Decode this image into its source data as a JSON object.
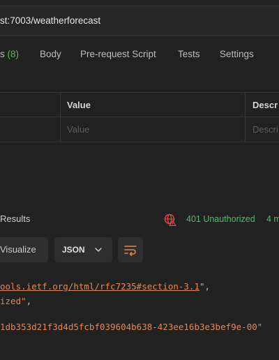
{
  "url_bar": {
    "url": "st:7003/weatherforecast"
  },
  "request_tabs": [
    {
      "label": "s",
      "count": "(8)"
    },
    {
      "label": "Body"
    },
    {
      "label": "Pre-request Script"
    },
    {
      "label": "Tests"
    },
    {
      "label": "Settings"
    }
  ],
  "params_table": {
    "headers": {
      "value": "Value",
      "description": "Descr"
    },
    "placeholders": {
      "value": "Value",
      "description": "Descri"
    }
  },
  "response": {
    "results_label": "Results",
    "status_icon": "globe-alert-icon",
    "status": "401 Unauthorized",
    "time": "4 m",
    "status_color": "#4fbf6a"
  },
  "toolbar": {
    "visualize_label": "Visualize",
    "format_label": "JSON",
    "format_chevron_icon": "chevron-down-icon",
    "wrap_icon": "wrap-lines-icon",
    "accent": "#e8844a"
  },
  "body_lines": {
    "line1_link": "ools.ietf.org/html/rfc7235#section-3.1",
    "line1_tail": "\",",
    "line2_str": "ized\"",
    "line2_tail": ",",
    "line3_str": "1db353d21f3d4d5fcbf039604b638-423ee16b3e3bef9e-00\""
  }
}
